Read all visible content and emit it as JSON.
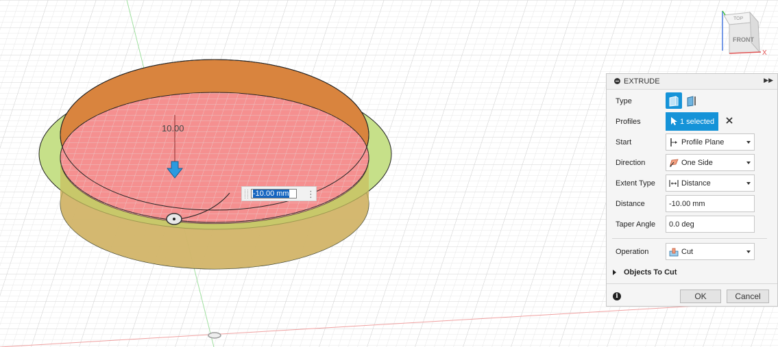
{
  "canvas": {
    "dimension_label": "10.00",
    "dimension_input_value": "-10.00 mm",
    "colors": {
      "grid": "#e4e4e4",
      "grid_major": "#d4d4d4",
      "cut_fill": "#f48a8a",
      "ring_fill": "#c4df85",
      "inner_wall": "#d9843e",
      "arrow": "#2a9ae0",
      "axis_green": "#9fe09f",
      "axis_red": "#f0a0a0"
    }
  },
  "viewcube": {
    "top_label": "TOP",
    "front_label": "FRONT",
    "x_label": "X"
  },
  "dialog": {
    "title": "EXTRUDE",
    "type_label": "Type",
    "profiles_label": "Profiles",
    "profiles_value": "1 selected",
    "start_label": "Start",
    "start_value": "Profile Plane",
    "direction_label": "Direction",
    "direction_value": "One Side",
    "extent_type_label": "Extent Type",
    "extent_type_value": "Distance",
    "distance_label": "Distance",
    "distance_value": "-10.00 mm",
    "taper_angle_label": "Taper Angle",
    "taper_angle_value": "0.0 deg",
    "operation_label": "Operation",
    "operation_value": "Cut",
    "objects_to_cut_label": "Objects To Cut",
    "ok_label": "OK",
    "cancel_label": "Cancel"
  }
}
